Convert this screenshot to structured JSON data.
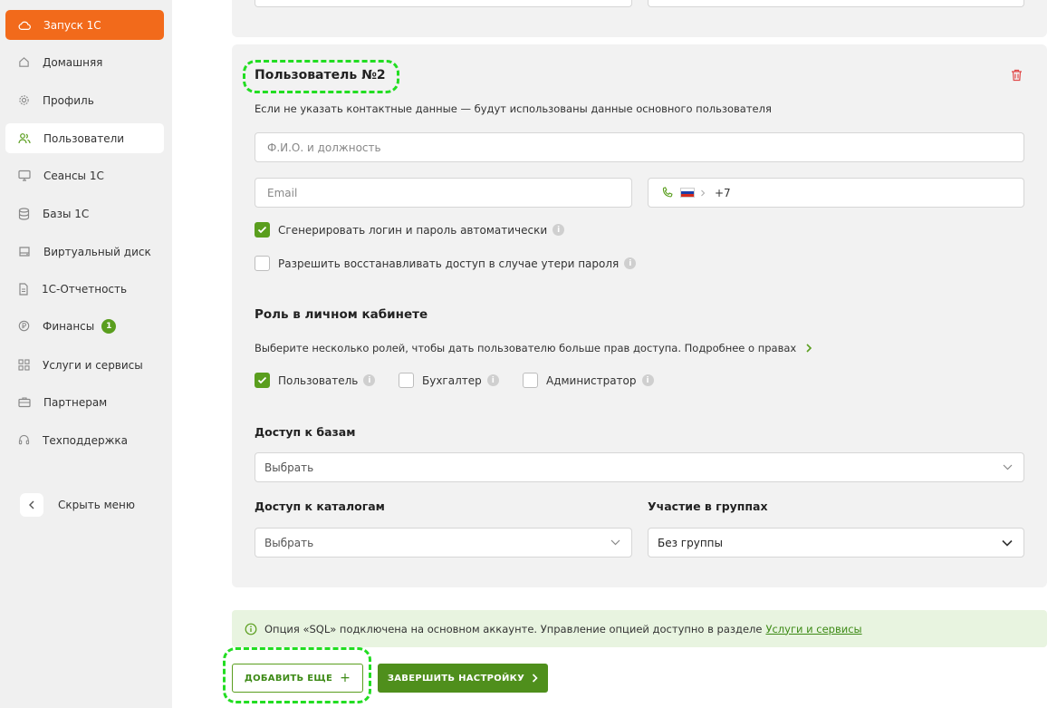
{
  "sidebar": {
    "launch_label": "Запуск 1С",
    "items": [
      {
        "label": "Домашняя",
        "icon": "home-icon"
      },
      {
        "label": "Профиль",
        "icon": "gear-icon"
      },
      {
        "label": "Пользователи",
        "icon": "users-icon",
        "active": true
      },
      {
        "label": "Сеансы 1С",
        "icon": "monitor-icon"
      },
      {
        "label": "Базы 1С",
        "icon": "database-icon"
      },
      {
        "label": "Виртуальный диск",
        "icon": "disk-icon"
      },
      {
        "label": "1С-Отчетность",
        "icon": "document-icon"
      },
      {
        "label": "Финансы",
        "icon": "ruble-icon",
        "badge": "1"
      },
      {
        "label": "Услуги и сервисы",
        "icon": "grid-icon"
      },
      {
        "label": "Партнерам",
        "icon": "briefcase-icon"
      },
      {
        "label": "Техподдержка",
        "icon": "headset-icon"
      }
    ],
    "hide_menu_label": "Скрыть меню"
  },
  "user_card": {
    "title": "Пользователь №2",
    "hint": "Если не указать контактные данные — будут использованы данные основного пользователя",
    "name_placeholder": "Ф.И.О. и должность",
    "email_placeholder": "Email",
    "phone_prefix": "+7",
    "options": {
      "auto_login_label": "Сгенерировать логин и пароль автоматически",
      "auto_login_checked": true,
      "restore_label": "Разрешить восстанавливать доступ в случае утери пароля",
      "restore_checked": false
    },
    "roles_title": "Роль в личном кабинете",
    "roles_hint": "Выберите несколько ролей, чтобы дать пользователю больше прав доступа. Подробнее о правах",
    "roles": {
      "user_label": "Пользователь",
      "user_checked": true,
      "accountant_label": "Бухгалтер",
      "accountant_checked": false,
      "admin_label": "Администратор",
      "admin_checked": false
    },
    "bases_title": "Доступ к базам",
    "bases_value": "Выбрать",
    "catalogs_title": "Доступ к каталогам",
    "catalogs_value": "Выбрать",
    "groups_title": "Участие в группах",
    "groups_value": "Без группы"
  },
  "notice": {
    "text": "Опция «SQL» подключена на основном аккаунте. Управление опцией доступно в разделе",
    "link": "Услуги и сервисы"
  },
  "actions": {
    "add_more_label": "ДОБАВИТЬ ЕЩЕ",
    "add_more_plus": "+",
    "finish_label": "ЗАВЕРШИТЬ НАСТРОЙКУ"
  },
  "colors": {
    "accent_orange": "#f26a1b",
    "accent_green": "#5a9e1e",
    "highlight": "#22dd22"
  }
}
